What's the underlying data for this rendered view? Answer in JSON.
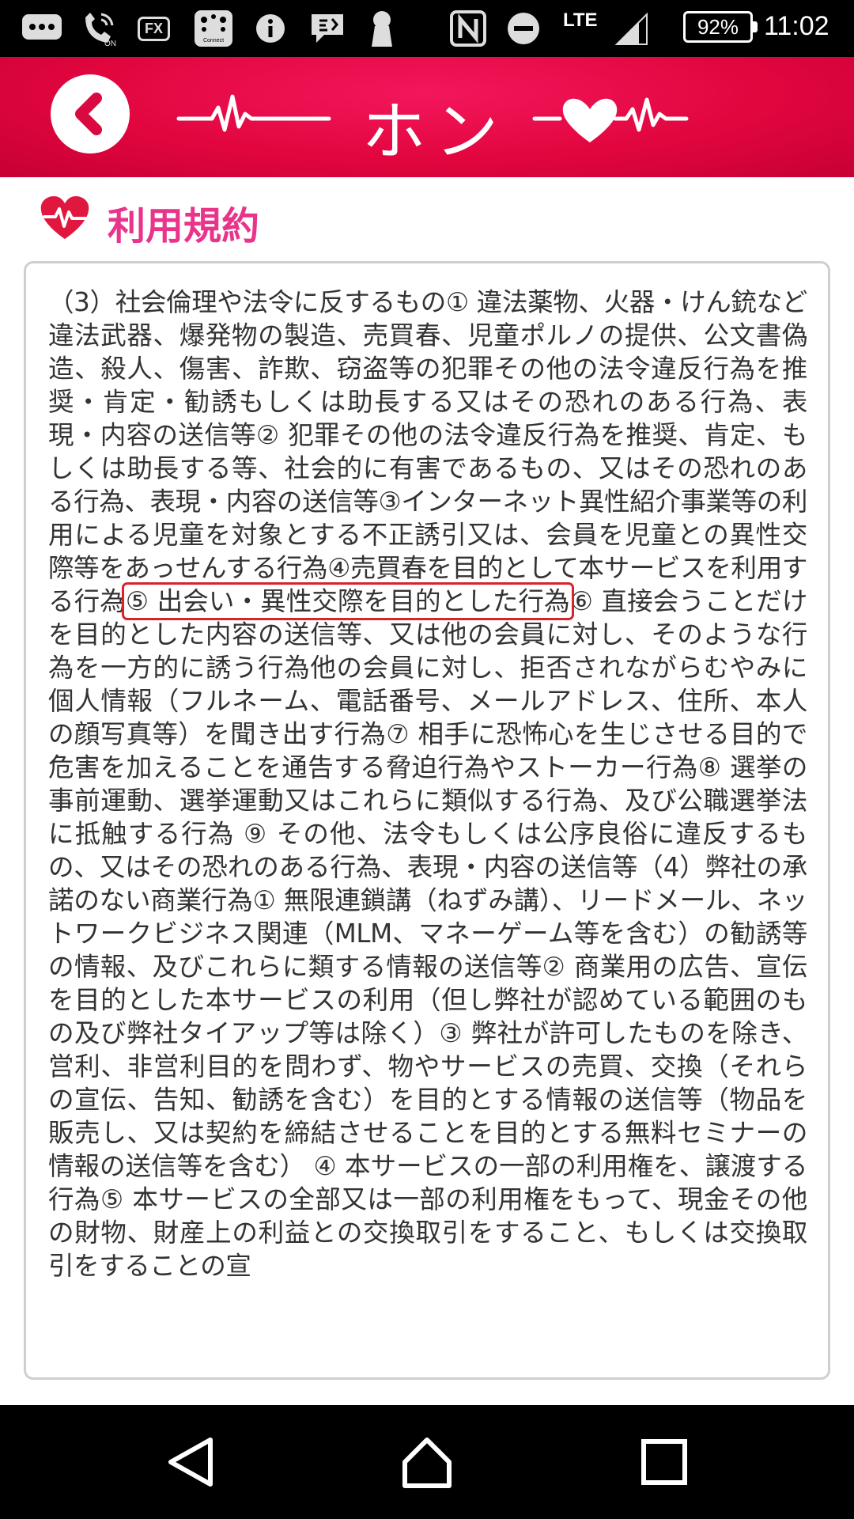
{
  "status_bar": {
    "icons": [
      "messages-icon",
      "wifi-calling-icon",
      "fx-icon",
      "connect-icon",
      "info-icon",
      "voicemail-icon",
      "keyhole-icon",
      "nfc-icon",
      "do-not-disturb-icon"
    ],
    "fx_label": "FX",
    "connect_label": "Connect",
    "on_label": "ON",
    "network": "LTE",
    "battery": "92%",
    "time": "11:02"
  },
  "header": {
    "logo": "ホンネ",
    "accent_color": "#e2063f"
  },
  "page": {
    "title": "利用規約",
    "title_color": "#e8348a"
  },
  "terms": {
    "before_highlight": "（3）社会倫理や法令に反するもの① 違法薬物、火器・けん銃など違法武器、爆発物の製造、売買春、児童ポルノの提供、公文書偽造、殺人、傷害、詐欺、窃盗等の犯罪その他の法令違反行為を推奨・肯定・勧誘もしくは助長する又はその恐れのある行為、表現・内容の送信等② 犯罪その他の法令違反行為を推奨、肯定、もしくは助長する等、社会的に有害であるもの、又はその恐れのある行為、表現・内容の送信等③インターネット異性紹介事業等の利用による児童を対象とする不正誘引又は、会員を児童との異性交際等をあっせんする行為④売買春を目的として本サービスを利用する行為",
    "highlighted": "⑤ 出会い・異性交際を目的とした行為",
    "after_highlight": "⑥ 直接会うことだけを目的とした内容の送信等、又は他の会員に対し、そのような行為を一方的に誘う行為他の会員に対し、拒否されながらむやみに個人情報（フルネーム、電話番号、メールアドレス、住所、本人の顔写真等）を聞き出す行為⑦ 相手に恐怖心を生じさせる目的で危害を加えることを通告する脅迫行為やストーカー行為⑧ 選挙の事前運動、選挙運動又はこれらに類似する行為、及び公職選挙法に抵触する行為 ⑨ その他、法令もしくは公序良俗に違反するもの、又はその恐れのある行為、表現・内容の送信等（4）弊社の承諾のない商業行為① 無限連鎖講（ねずみ講）、リードメール、ネットワークビジネス関連（MLM、マネーゲーム等を含む）の勧誘等の情報、及びこれらに類する情報の送信等② 商業用の広告、宣伝を目的とした本サービスの利用（但し弊社が認めている範囲のもの及び弊社タイアップ等は除く）③ 弊社が許可したものを除き、営利、非営利目的を問わず、物やサービスの売買、交換（それらの宣伝、告知、勧誘を含む）を目的とする情報の送信等（物品を販売し、又は契約を締結させることを目的とする無料セミナーの情報の送信等を含む） ④ 本サービスの一部の利用権を、譲渡する行為⑤ 本サービスの全部又は一部の利用権をもって、現金その他の財物、財産上の利益との交換取引をすること、もしくは交換取引をすることの宣"
  },
  "nav": {
    "items": [
      "back-nav-icon",
      "home-nav-icon",
      "recents-nav-icon"
    ]
  }
}
